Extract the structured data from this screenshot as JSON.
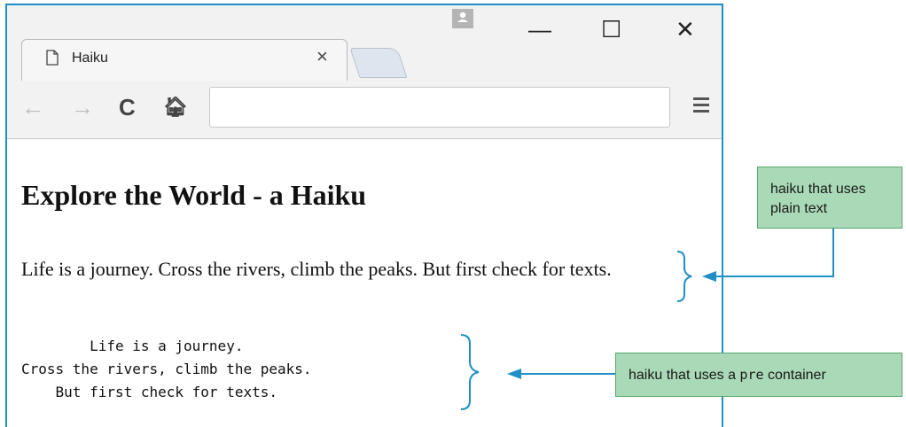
{
  "browser": {
    "tab_title": "Haiku",
    "tab_close": "×",
    "window_buttons": {
      "minimize": "—",
      "maximize": "☐",
      "close": "✕"
    },
    "nav": {
      "back": "←",
      "forward": "→",
      "reload": "C",
      "home": "🏠︎"
    },
    "address_value": ""
  },
  "page": {
    "heading": "Explore the World - a Haiku",
    "plain_haiku": "Life is a journey. Cross the rivers, climb the peaks. But first check for texts.",
    "pre_haiku": "        Life is a journey.\nCross the rivers, climb the peaks.\n    But first check for texts."
  },
  "annotations": {
    "top_label": "haiku that uses plain text",
    "bottom_label_prefix": "haiku that uses a ",
    "bottom_label_code": "pre",
    "bottom_label_suffix": " container"
  },
  "colors": {
    "window_border": "#1f8fc5",
    "callout_fill": "#a9d9b6",
    "arrow": "#1f8fc5"
  }
}
